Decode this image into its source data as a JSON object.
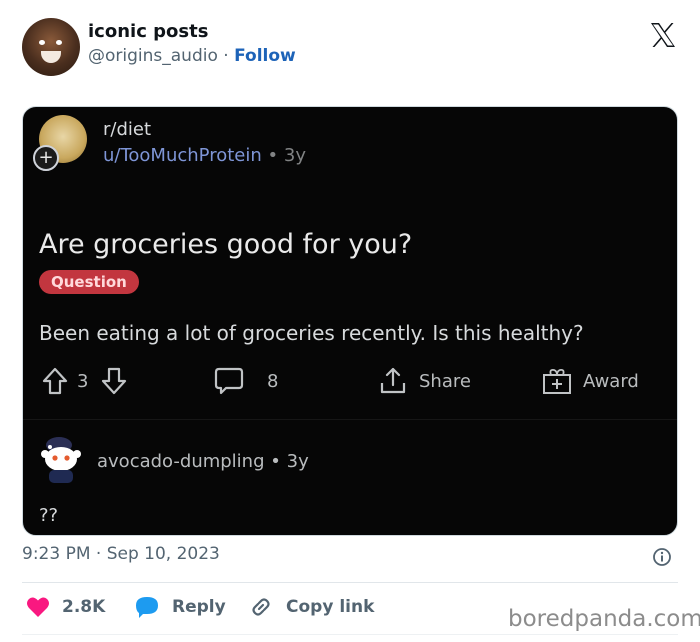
{
  "author": {
    "display_name": "iconic posts",
    "handle": "@origins_audio",
    "separator": "·",
    "follow_label": "Follow"
  },
  "embedded_post": {
    "subreddit": "r/diet",
    "user": "u/TooMuchProtein",
    "dot": "•",
    "age": "3y",
    "title": "Are groceries good for you?",
    "flair": "Question",
    "body": "Been eating a lot of groceries recently. Is this healthy?",
    "actions": {
      "upvotes": "3",
      "comments": "8",
      "share_label": "Share",
      "award_label": "Award"
    },
    "comment": {
      "author": "avocado-dumpling",
      "dot": "•",
      "age": "3y",
      "text": "??"
    }
  },
  "meta": {
    "timestamp": "9:23 PM · Sep 10, 2023"
  },
  "footer": {
    "likes": "2.8K",
    "reply_label": "Reply",
    "copy_link_label": "Copy link"
  },
  "watermark": "boredpanda.com",
  "colors": {
    "follow": "#1d63b8",
    "like_heart": "#f91880",
    "reply_bubble": "#1d9bf0",
    "flair_bg": "#c2363f",
    "post_bg": "#060606"
  }
}
